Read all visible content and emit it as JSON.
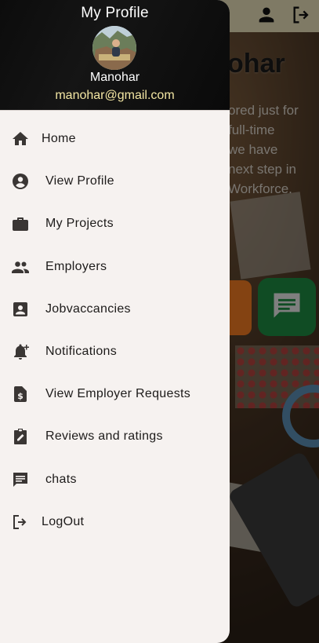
{
  "background": {
    "hero_title": "ohar",
    "hero_lines": [
      "ored just for",
      "full-time",
      "we have",
      "next step in",
      "Workforce."
    ]
  },
  "drawer": {
    "header": {
      "title": "My Profile",
      "name": "Manohar",
      "email": "manohar@gmail.com"
    },
    "items": [
      {
        "label": "Home",
        "icon": "home-icon"
      },
      {
        "label": "View Profile",
        "icon": "account-circle-icon"
      },
      {
        "label": "My Projects",
        "icon": "briefcase-icon"
      },
      {
        "label": "Employers",
        "icon": "people-icon"
      },
      {
        "label": "Jobvaccancies",
        "icon": "contact-card-icon"
      },
      {
        "label": "Notifications",
        "icon": "notification-add-icon"
      },
      {
        "label": "View Employer Requests",
        "icon": "invoice-dollar-icon"
      },
      {
        "label": "Reviews and ratings",
        "icon": "assignment-edit-icon"
      },
      {
        "label": "chats",
        "icon": "chat-icon"
      },
      {
        "label": "LogOut",
        "icon": "logout-icon"
      }
    ]
  },
  "colors": {
    "drawer_bg": "#f6f2f0",
    "header_bg": "#0c0c0c",
    "email": "#f3e6a3",
    "icon": "#3a3634"
  }
}
